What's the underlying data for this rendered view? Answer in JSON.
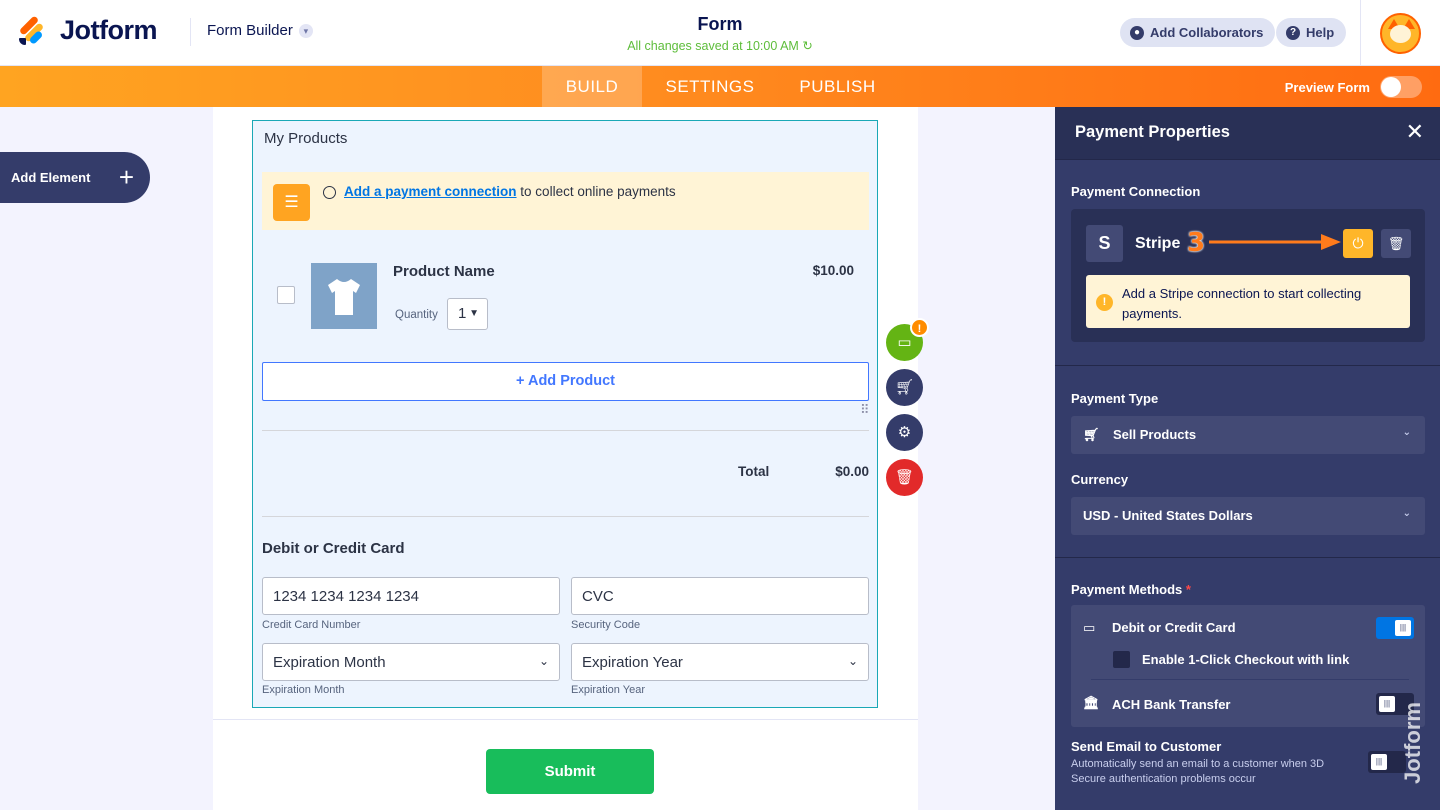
{
  "header": {
    "brand": "Jotform",
    "builder_label": "Form Builder",
    "form_title": "Form",
    "save_status": "All changes saved at 10:00 AM",
    "add_collaborators": "Add Collaborators",
    "help": "Help"
  },
  "nav": {
    "tabs": [
      "BUILD",
      "SETTINGS",
      "PUBLISH"
    ],
    "active_tab": "BUILD",
    "preview_label": "Preview Form",
    "preview_enabled": false
  },
  "sidebar": {
    "add_element": "Add Element"
  },
  "form": {
    "products_title": "My Products",
    "notice_link": "Add a payment connection",
    "notice_text": "to collect online payments",
    "product": {
      "name": "Product Name",
      "price": "$10.00",
      "quantity_label": "Quantity",
      "quantity_value": "1"
    },
    "add_product": "+ Add Product",
    "total_label": "Total",
    "total_value": "$0.00",
    "card_title": "Debit or Credit Card",
    "card_number_placeholder": "1234 1234 1234 1234",
    "card_number_label": "Credit Card Number",
    "cvc_placeholder": "CVC",
    "cvc_label": "Security Code",
    "exp_month_value": "Expiration Month",
    "exp_month_label": "Expiration Month",
    "exp_year_value": "Expiration Year",
    "exp_year_label": "Expiration Year",
    "submit": "Submit",
    "tool_badge": "!"
  },
  "panel": {
    "title": "Payment Properties",
    "connection_label": "Payment Connection",
    "gateway_initial": "S",
    "gateway_name": "Stripe",
    "step_number": "3",
    "warning": "Add a Stripe connection to start collecting payments.",
    "payment_type_label": "Payment Type",
    "payment_type_value": "Sell Products",
    "currency_label": "Currency",
    "currency_value": "USD - United States Dollars",
    "methods_label": "Payment Methods",
    "required_mark": "*",
    "methods": [
      {
        "label": "Debit or Credit Card",
        "enabled": true
      },
      {
        "label": "Enable 1-Click Checkout with link",
        "checked": false
      },
      {
        "label": "ACH Bank Transfer",
        "enabled": false
      }
    ],
    "send_email_label": "Send Email to Customer",
    "send_email_desc": "Automatically send an email to a customer when 3D Secure authentication problems occur",
    "send_email_enabled": false
  },
  "watermark": {
    "brand": "Jotform"
  },
  "colors": {
    "accent_orange": "#ff6100",
    "panel_bg": "#343c6a",
    "field_border": "#1aa8b6",
    "submit_green": "#18bd5b",
    "link_blue": "#0075e3"
  }
}
